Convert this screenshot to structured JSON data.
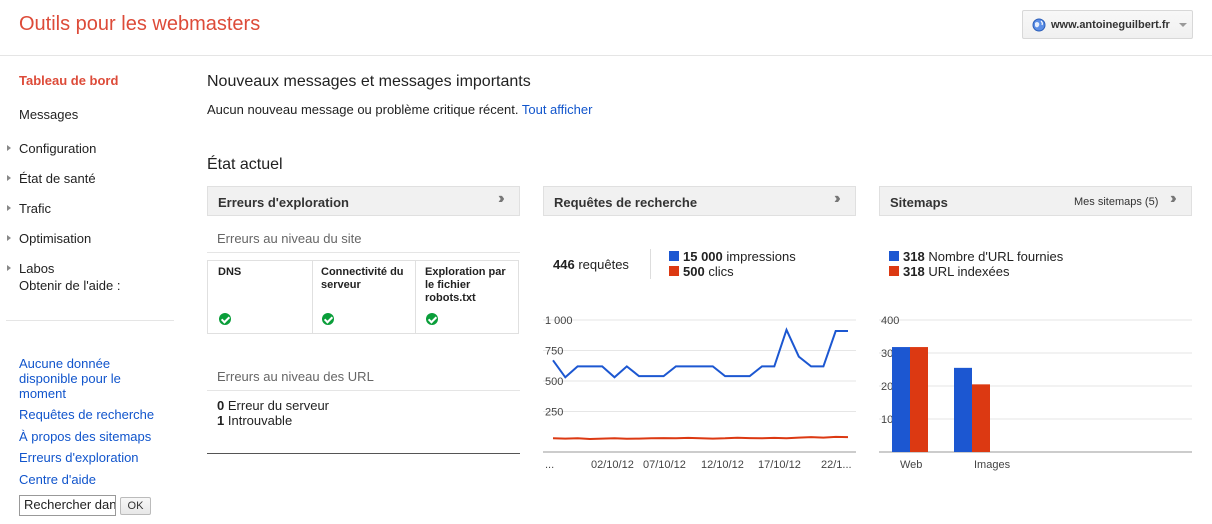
{
  "header": {
    "app_title": "Outils pour les webmasters",
    "site": "www.antoineguilbert.fr"
  },
  "sidebar": {
    "items": [
      {
        "label": "Tableau de bord"
      },
      {
        "label": "Messages"
      },
      {
        "label": "Configuration"
      },
      {
        "label": "État de santé"
      },
      {
        "label": "Trafic"
      },
      {
        "label": "Optimisation"
      },
      {
        "label": "Labos"
      }
    ],
    "help": {
      "title": "Obtenir de l'aide :",
      "links": [
        {
          "label": "Aucune donnée disponible pour le moment"
        },
        {
          "label": "Requêtes de recherche"
        },
        {
          "label": "À propos des sitemaps"
        },
        {
          "label": "Erreurs d'exploration"
        },
        {
          "label": "Centre d'aide"
        }
      ],
      "search_value": "Rechercher dans",
      "ok_label": "OK"
    }
  },
  "messages": {
    "title": "Nouveaux messages et messages importants",
    "text": "Aucun nouveau message ou problème critique récent.",
    "link": "Tout afficher"
  },
  "status": {
    "title": "État actuel"
  },
  "crawl": {
    "title": "Erreurs d'exploration",
    "site_level": "Erreurs au niveau du site",
    "cells": [
      {
        "label": "DNS",
        "status": "ok"
      },
      {
        "label": "Connectivité du serveur",
        "status": "ok"
      },
      {
        "label": "Exploration par le fichier robots.txt",
        "status": "ok"
      }
    ],
    "url_level": "Erreurs au niveau des URL",
    "url_errors": [
      {
        "count": "0",
        "label": "Erreur du serveur"
      },
      {
        "count": "1",
        "label": "Introuvable"
      }
    ]
  },
  "queries": {
    "title": "Requêtes de recherche",
    "count": "446",
    "count_label": "requêtes",
    "impressions": "15 000",
    "impressions_label": "impressions",
    "clicks": "500",
    "clicks_label": "clics"
  },
  "sitemaps": {
    "title": "Sitemaps",
    "link": "Mes sitemaps (5)",
    "submitted": "318",
    "submitted_label": "Nombre d'URL fournies",
    "indexed": "318",
    "indexed_label": "URL indexées"
  },
  "colors": {
    "blue": "#1c57d1",
    "red": "#dc3912",
    "brand": "#dd4b39",
    "link": "#1155cc"
  },
  "chart_data": [
    {
      "type": "line",
      "title": "",
      "ylim": [
        0,
        1000
      ],
      "y_ticks": [
        "1 000",
        "750",
        "500",
        "250"
      ],
      "x_ticks": [
        "...",
        "02/10/12",
        "07/10/12",
        "12/10/12",
        "17/10/12",
        "22/1..."
      ],
      "series": [
        {
          "name": "impressions",
          "color": "#1c57d1",
          "values": [
            670,
            530,
            620,
            620,
            620,
            530,
            620,
            540,
            540,
            540,
            620,
            620,
            620,
            620,
            540,
            540,
            540,
            620,
            620,
            920,
            700,
            620,
            620,
            910,
            910
          ]
        },
        {
          "name": "clics",
          "color": "#dc3912",
          "values": [
            30,
            28,
            30,
            25,
            28,
            30,
            26,
            28,
            30,
            32,
            30,
            34,
            30,
            28,
            30,
            35,
            32,
            30,
            34,
            30,
            36,
            40,
            36,
            42,
            40
          ]
        }
      ]
    },
    {
      "type": "bar",
      "title": "",
      "ylim": [
        0,
        400
      ],
      "y_ticks": [
        "400",
        "300",
        "200",
        "100"
      ],
      "categories": [
        "Web",
        "Images"
      ],
      "series": [
        {
          "name": "Nombre d'URL fournies",
          "color": "#1c57d1",
          "values": [
            318,
            255
          ]
        },
        {
          "name": "URL indexées",
          "color": "#dc3912",
          "values": [
            318,
            205
          ]
        }
      ]
    }
  ]
}
